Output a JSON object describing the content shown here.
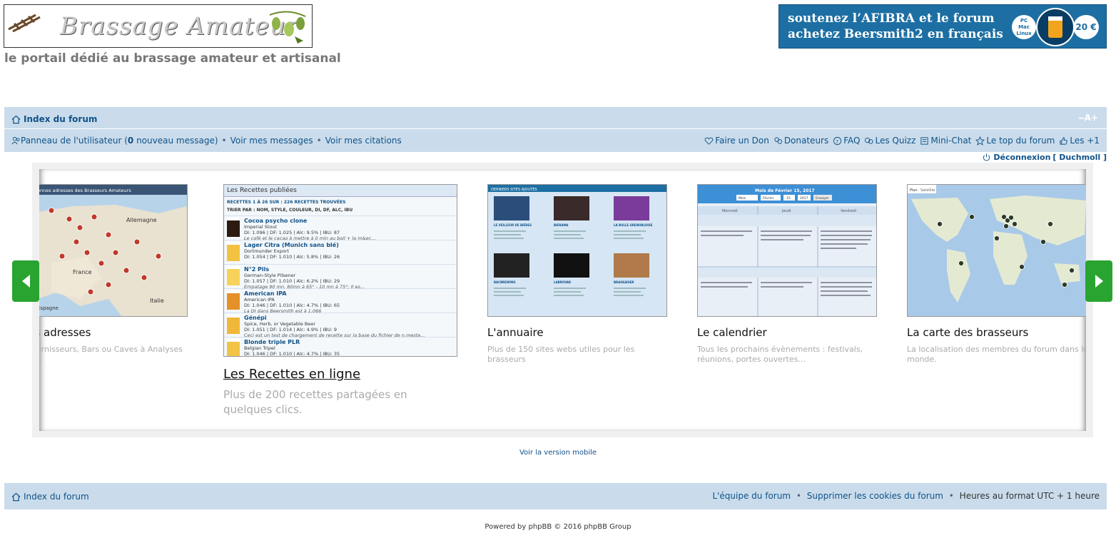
{
  "header": {
    "logo_text": "Brassage Amateur",
    "tagline": "le portail dédié au brassage amateur et artisanal",
    "ad": {
      "line1": "soutenez l’AFIBRA et le forum",
      "line2": "achetez Beersmith2 en français",
      "platforms": [
        "PC",
        "Mac",
        "Linux"
      ],
      "price": "20 €"
    }
  },
  "nav": {
    "breadcrumb": "Index du forum",
    "font_size_control": "‒A+",
    "user_panel_prefix": "Panneau de l'utilisateur (",
    "new_msg_count": "0",
    "user_panel_suffix": " nouveau message)",
    "sep": "•",
    "my_messages": "Voir mes messages",
    "my_quotes": "Voir mes citations",
    "right_links": [
      "Faire un Don",
      "Donateurs",
      "FAQ",
      "Les Quizz",
      "Mini-Chat",
      "Le top du forum",
      "Les +1"
    ],
    "logout": "Déconnexion",
    "username": "[ Duchmoll ]"
  },
  "carousel": {
    "cards": [
      {
        "title": "onnes adresses",
        "desc": "ries, Fournisseurs, Bars ou Caves à Analyses d'eaux...",
        "thumb_caption": "onnes adresses des Brasseurs Amateurs",
        "labels": [
          "Allemagne",
          "France",
          "Italie",
          "Espagne"
        ]
      },
      {
        "title": "Les Recettes en ligne",
        "desc": "Plus de 200 recettes partagées en quelques clics."
      },
      {
        "title": "L'annuaire",
        "desc": "Plus de 150 sites webs utiles pour les brasseurs",
        "thumb_caption": "DERNIERS SITES AJOUTÉS",
        "entries": [
          "LE VEILLEUR DE BIÈRES",
          "BIERAMA",
          "LA BULLE GRENOBLOISE",
          "BACBREWING",
          "LABROVAR",
          "BRASKAISER"
        ]
      },
      {
        "title": "Le calendrier",
        "desc": "Tous les prochains évènements : festivals, réunions, portes ouvertes...",
        "thumb_caption": "Mois de Février 15, 2017",
        "controls": [
          "Mois",
          "Février",
          "15",
          "2017",
          "Envoyer"
        ],
        "days": [
          "Mercredi",
          "Jeudi",
          "Vendredi"
        ]
      },
      {
        "title": "La carte des brasseurs",
        "desc": "La localisation des membres du forum dans le monde.",
        "thumb_tabs": [
          "Plan",
          "Satellite"
        ]
      }
    ],
    "recipes": {
      "header": "Les Recettes publiées",
      "count": "RECETTES 1 À 26 SUR : 226 RECETTES TROUVÉES",
      "sort": "TRIER PAR : NOM, STYLE, COULEUR, DI, DF, ALC, IBU",
      "items": [
        {
          "name": "Cocoa psycho clone",
          "style": "Imperial Stout",
          "stats": "DI: 1.096 | DF: 1.025 | Alc: 9.5% | IBU: 87",
          "note": "Le café et le cacao à mettre à 0 min au boil + la m&ec...",
          "color": "#2a1a10"
        },
        {
          "name": "Lager Citra (Munich sans blé)",
          "style": "Dortmunder Export",
          "stats": "DI: 1.054 | DF: 1.010 | Alc: 5.8% | IBU: 26",
          "note": "",
          "color": "#f3c240"
        },
        {
          "name": "N°2 Pils",
          "style": "German-Style Pilsener",
          "stats": "DI: 1.057 | DF: 1.010 | Alc: 6.2% | IBU: 29",
          "note": "Empatage 90 mn. 80mn à 65° - 10 mn à 75°; Il es...",
          "color": "#f6d25a"
        },
        {
          "name": "American IPA",
          "style": "American IPA",
          "stats": "DI: 1.046 | DF: 1.010 | Alc: 4.7% | IBU: 65",
          "note": "La DI dans Beersmith est à 1.066",
          "color": "#e6902a"
        },
        {
          "name": "Génépi",
          "style": "Spice, Herb, or Vegetable Beer",
          "stats": "DI: 1.051 | DF: 1.014 | Alc: 4.9% | IBU: 9",
          "note": "Ceci est un test de chargement de recette sur la base du fichier de n.meste...",
          "color": "#f0b838"
        },
        {
          "name": "Blonde triple PLR",
          "style": "Belgian Tripel",
          "stats": "DI: 1.046 | DF: 1.010 | Alc: 4.7% | IBU: 35",
          "note": "",
          "color": "#f2c445"
        }
      ]
    }
  },
  "footer": {
    "mobile_link": "Voir la version mobile",
    "breadcrumb": "Index du forum",
    "links": [
      "L'équipe du forum",
      "Supprimer les cookies du forum"
    ],
    "timezone": "Heures au format UTC + 1 heure",
    "sep": "•",
    "powered": "Powered by phpBB © 2016 phpBB Group"
  },
  "colors": {
    "link": "#105289",
    "navbar": "#cadceb",
    "arrow": "#2aa430"
  },
  "icons": [
    "home-icon",
    "user-icon",
    "heart-icon",
    "donors-icon",
    "faq-icon",
    "quiz-icon",
    "chat-icon",
    "star-icon",
    "thumb-icon",
    "power-icon",
    "arrow-left-icon",
    "arrow-right-icon"
  ]
}
